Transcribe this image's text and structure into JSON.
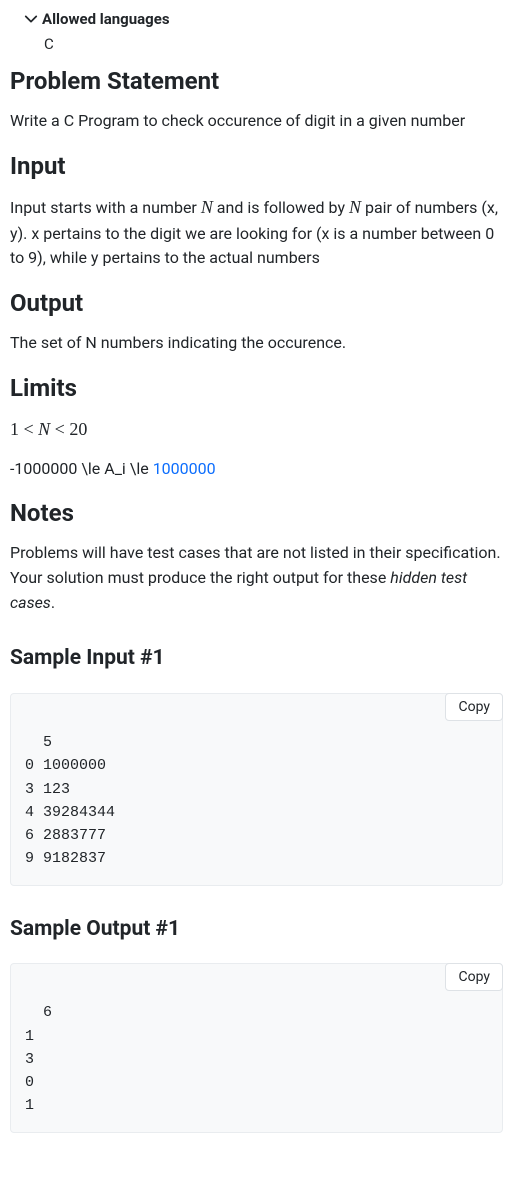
{
  "allowed": {
    "label": "Allowed languages",
    "value": "C"
  },
  "sections": {
    "problem_statement": {
      "title": "Problem Statement",
      "text": "Write a C Program to check occurence of digit in a given number"
    },
    "input": {
      "title": "Input",
      "text_pre": "Input starts with a number ",
      "text_mid": " and is followed by ",
      "text_post": " pair of numbers (x, y). x pertains to the digit we are looking for (x is a number between 0 to 9), while y pertains to the actual numbers",
      "N": "N"
    },
    "output": {
      "title": "Output",
      "text": "The set of N numbers indicating the occurence."
    },
    "limits": {
      "title": "Limits",
      "line1_a": "1 < ",
      "line1_n": "N",
      "line1_b": " < 20",
      "line2_a": "-1000000 \\le A_i \\le ",
      "line2_b": "1000000"
    },
    "notes": {
      "title": "Notes",
      "text_a": "Problems will have test cases that are not listed in their specification. Your solution must produce the right output for these ",
      "text_em": "hidden test cases",
      "text_b": "."
    },
    "sample_input": {
      "title": "Sample Input #1",
      "copy_label": "Copy",
      "content": "5\n0 1000000\n3 123\n4 39284344\n6 2883777\n9 9182837"
    },
    "sample_output": {
      "title": "Sample Output #1",
      "copy_label": "Copy",
      "content": "6\n1\n3\n0\n1"
    }
  }
}
